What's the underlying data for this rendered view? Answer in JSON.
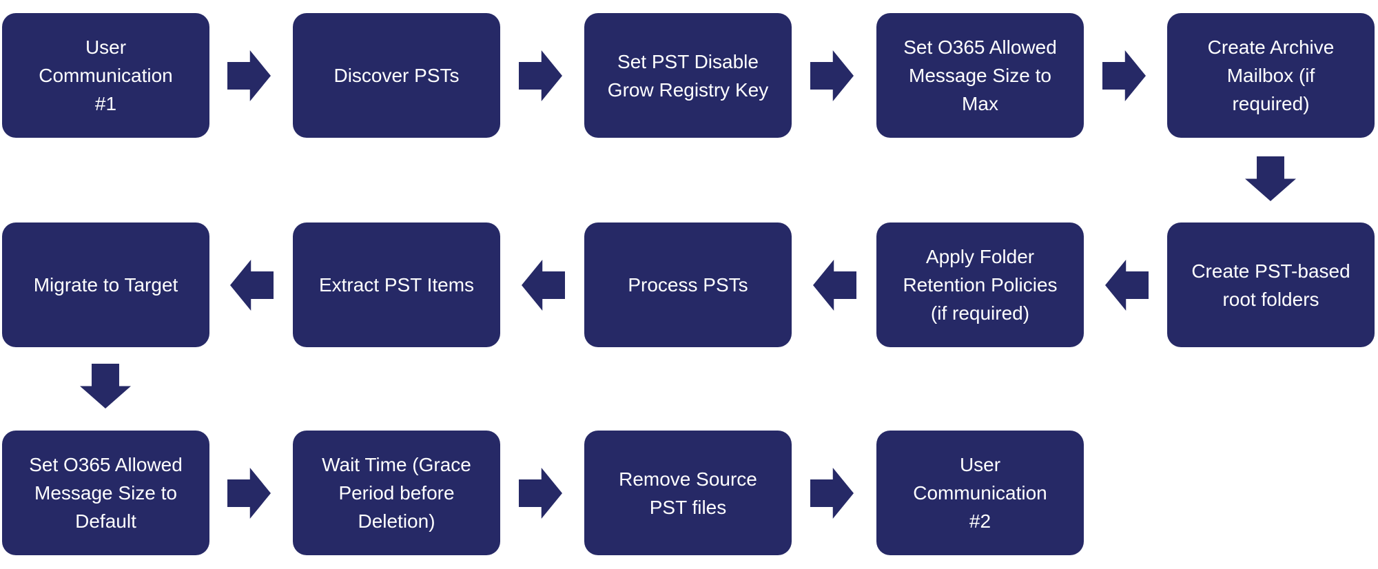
{
  "colors": {
    "box": "#262966",
    "arrow": "#262966",
    "text": "#ffffff"
  },
  "steps": [
    {
      "lines": [
        "User",
        "Communication",
        "#1"
      ]
    },
    {
      "lines": [
        "Discover PSTs"
      ]
    },
    {
      "lines": [
        "Set PST Disable",
        "Grow Registry Key"
      ]
    },
    {
      "lines": [
        "Set O365 Allowed",
        "Message Size to",
        "Max"
      ]
    },
    {
      "lines": [
        "Create Archive",
        "Mailbox (if",
        "required)"
      ]
    },
    {
      "lines": [
        "Create PST-based",
        "root folders"
      ]
    },
    {
      "lines": [
        "Apply Folder",
        "Retention Policies",
        "(if required)"
      ]
    },
    {
      "lines": [
        "Process PSTs"
      ]
    },
    {
      "lines": [
        "Extract PST Items"
      ]
    },
    {
      "lines": [
        "Migrate to Target"
      ]
    },
    {
      "lines": [
        "Set O365 Allowed",
        "Message Size to",
        "Default"
      ]
    },
    {
      "lines": [
        "Wait Time (Grace",
        "Period before",
        "Deletion)"
      ]
    },
    {
      "lines": [
        "Remove Source",
        "PST files"
      ]
    },
    {
      "lines": [
        "User",
        "Communication",
        "#2"
      ]
    }
  ]
}
